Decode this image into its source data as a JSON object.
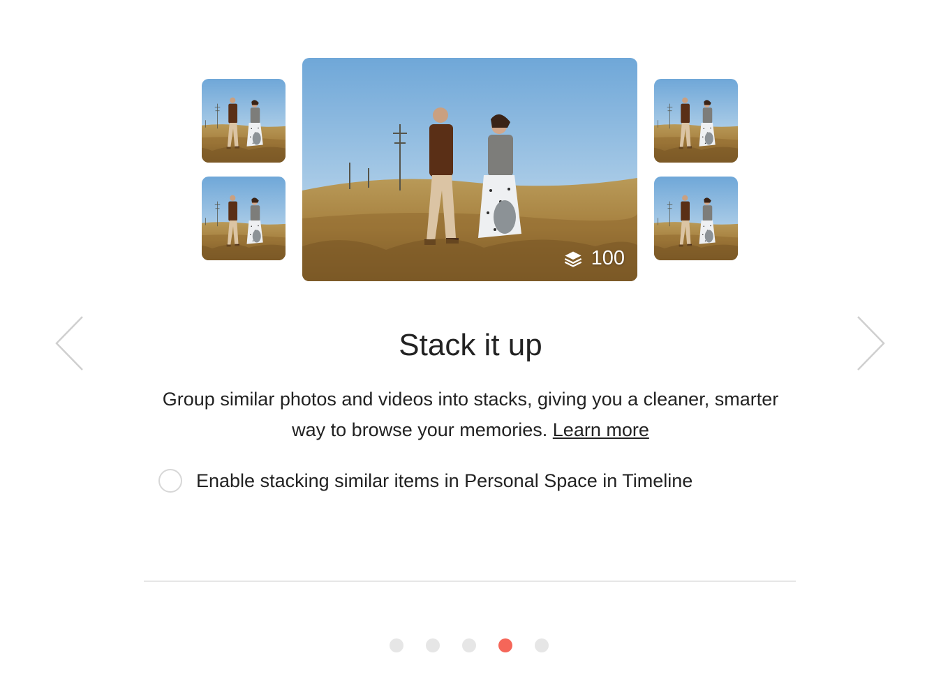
{
  "main_photo": {
    "stack_count": "100"
  },
  "title": "Stack it up",
  "description": {
    "text": "Group similar photos and videos into stacks, giving you a cleaner, smarter way to browse your memories.",
    "link_label": "Learn more"
  },
  "option": {
    "label": "Enable stacking similar items in Personal Space in Timeline",
    "checked": false
  },
  "pagination": {
    "count": 5,
    "active_index": 3,
    "active_color": "#f56659",
    "inactive_color": "#e6e6e6"
  },
  "icons": {
    "prev": "chevron-left-icon",
    "next": "chevron-right-icon",
    "stack": "layers-icon"
  }
}
